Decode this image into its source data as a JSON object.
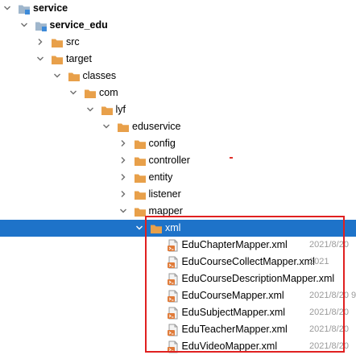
{
  "tree": {
    "nodes": [
      {
        "label": "service",
        "icon": "module-folder-icon",
        "expand": "expanded",
        "bold": true
      },
      {
        "label": "service_edu",
        "icon": "module-folder-icon",
        "expand": "expanded",
        "bold": true
      },
      {
        "label": "src",
        "icon": "folder-icon",
        "expand": "collapsed"
      },
      {
        "label": "target",
        "icon": "folder-icon",
        "expand": "expanded"
      },
      {
        "label": "classes",
        "icon": "folder-icon",
        "expand": "expanded"
      },
      {
        "label": "com",
        "icon": "folder-icon",
        "expand": "expanded"
      },
      {
        "label": "lyf",
        "icon": "folder-icon",
        "expand": "expanded"
      },
      {
        "label": "eduservice",
        "icon": "folder-icon",
        "expand": "expanded"
      },
      {
        "label": "config",
        "icon": "folder-icon",
        "expand": "collapsed"
      },
      {
        "label": "controller",
        "icon": "folder-icon",
        "expand": "collapsed"
      },
      {
        "label": "entity",
        "icon": "folder-icon",
        "expand": "collapsed"
      },
      {
        "label": "listener",
        "icon": "folder-icon",
        "expand": "collapsed"
      },
      {
        "label": "mapper",
        "icon": "folder-icon",
        "expand": "expanded"
      },
      {
        "label": "xml",
        "icon": "folder-icon",
        "expand": "expanded",
        "selected": true
      },
      {
        "label": "EduChapterMapper.xml",
        "icon": "xml-file-icon",
        "date": "2021/8/20"
      },
      {
        "label": "EduCourseCollectMapper.xml",
        "icon": "xml-file-icon",
        "date": "2021"
      },
      {
        "label": "EduCourseDescriptionMapper.xml",
        "icon": "xml-file-icon",
        "date": ""
      },
      {
        "label": "EduCourseMapper.xml",
        "icon": "xml-file-icon",
        "date": "2021/8/20 9"
      },
      {
        "label": "EduSubjectMapper.xml",
        "icon": "xml-file-icon",
        "date": "2021/8/20"
      },
      {
        "label": "EduTeacherMapper.xml",
        "icon": "xml-file-icon",
        "date": "2021/8/20"
      },
      {
        "label": "EduVideoMapper.xml",
        "icon": "xml-file-icon",
        "date": "2021/8/20"
      }
    ]
  },
  "colors": {
    "selection": "#1e73c9",
    "folder": "#e8a04a",
    "module_folder": "#9fb6cc",
    "highlight_box": "#e02020"
  }
}
